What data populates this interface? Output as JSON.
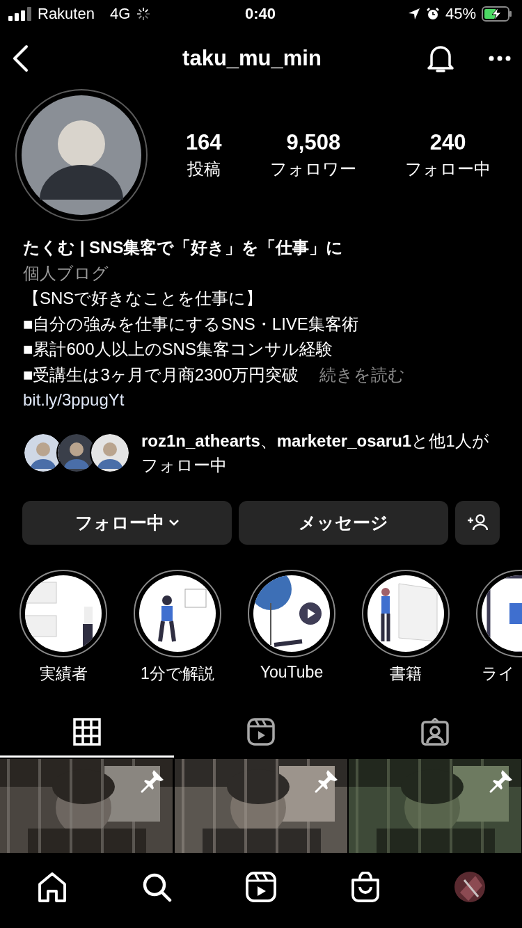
{
  "status_bar": {
    "carrier": "Rakuten",
    "network": "4G",
    "time": "0:40",
    "battery": "45%"
  },
  "header": {
    "title": "taku_mu_min"
  },
  "profile": {
    "stats": [
      {
        "value": "164",
        "label": "投稿"
      },
      {
        "value": "9,508",
        "label": "フォロワー"
      },
      {
        "value": "240",
        "label": "フォロー中"
      }
    ],
    "name": "たくむ | SNS集客で「好き」を「仕事」に",
    "category": "個人ブログ",
    "bio_lines": [
      "【SNSで好きなことを仕事に】",
      "■自分の強みを仕事にするSNS・LIVE集客術",
      "■累計600人以上のSNS集客コンサル経験",
      "■受講生は3ヶ月で月商2300万円突破"
    ],
    "more": "続きを読む",
    "link": "bit.ly/3ppugYt"
  },
  "followed_by": {
    "text": "**roz1n_athearts**、**marketer_osaru1**と他1人がフォロー中"
  },
  "buttons": [
    {
      "kind": "dropdown",
      "label": "フォロー中"
    },
    {
      "kind": "plain",
      "label": "メッセージ"
    },
    {
      "kind": "add-person"
    }
  ],
  "highlights": [
    {
      "label": "実績者"
    },
    {
      "label": "1分で解説"
    },
    {
      "label": "YouTube"
    },
    {
      "label": "書籍"
    },
    {
      "label": "ライ"
    }
  ],
  "tabs": [
    {
      "kind": "grid",
      "selected": true
    },
    {
      "kind": "reels",
      "selected": false
    },
    {
      "kind": "tagged",
      "selected": false
    }
  ],
  "posts": [
    {
      "kind": "picture",
      "pinned": true
    },
    {
      "kind": "picture",
      "pinned": true
    },
    {
      "kind": "picture",
      "pinned": true
    }
  ],
  "bottom_nav": [
    {
      "kind": "home"
    },
    {
      "kind": "search"
    },
    {
      "kind": "reels"
    },
    {
      "kind": "shop"
    },
    {
      "kind": "profile"
    }
  ]
}
